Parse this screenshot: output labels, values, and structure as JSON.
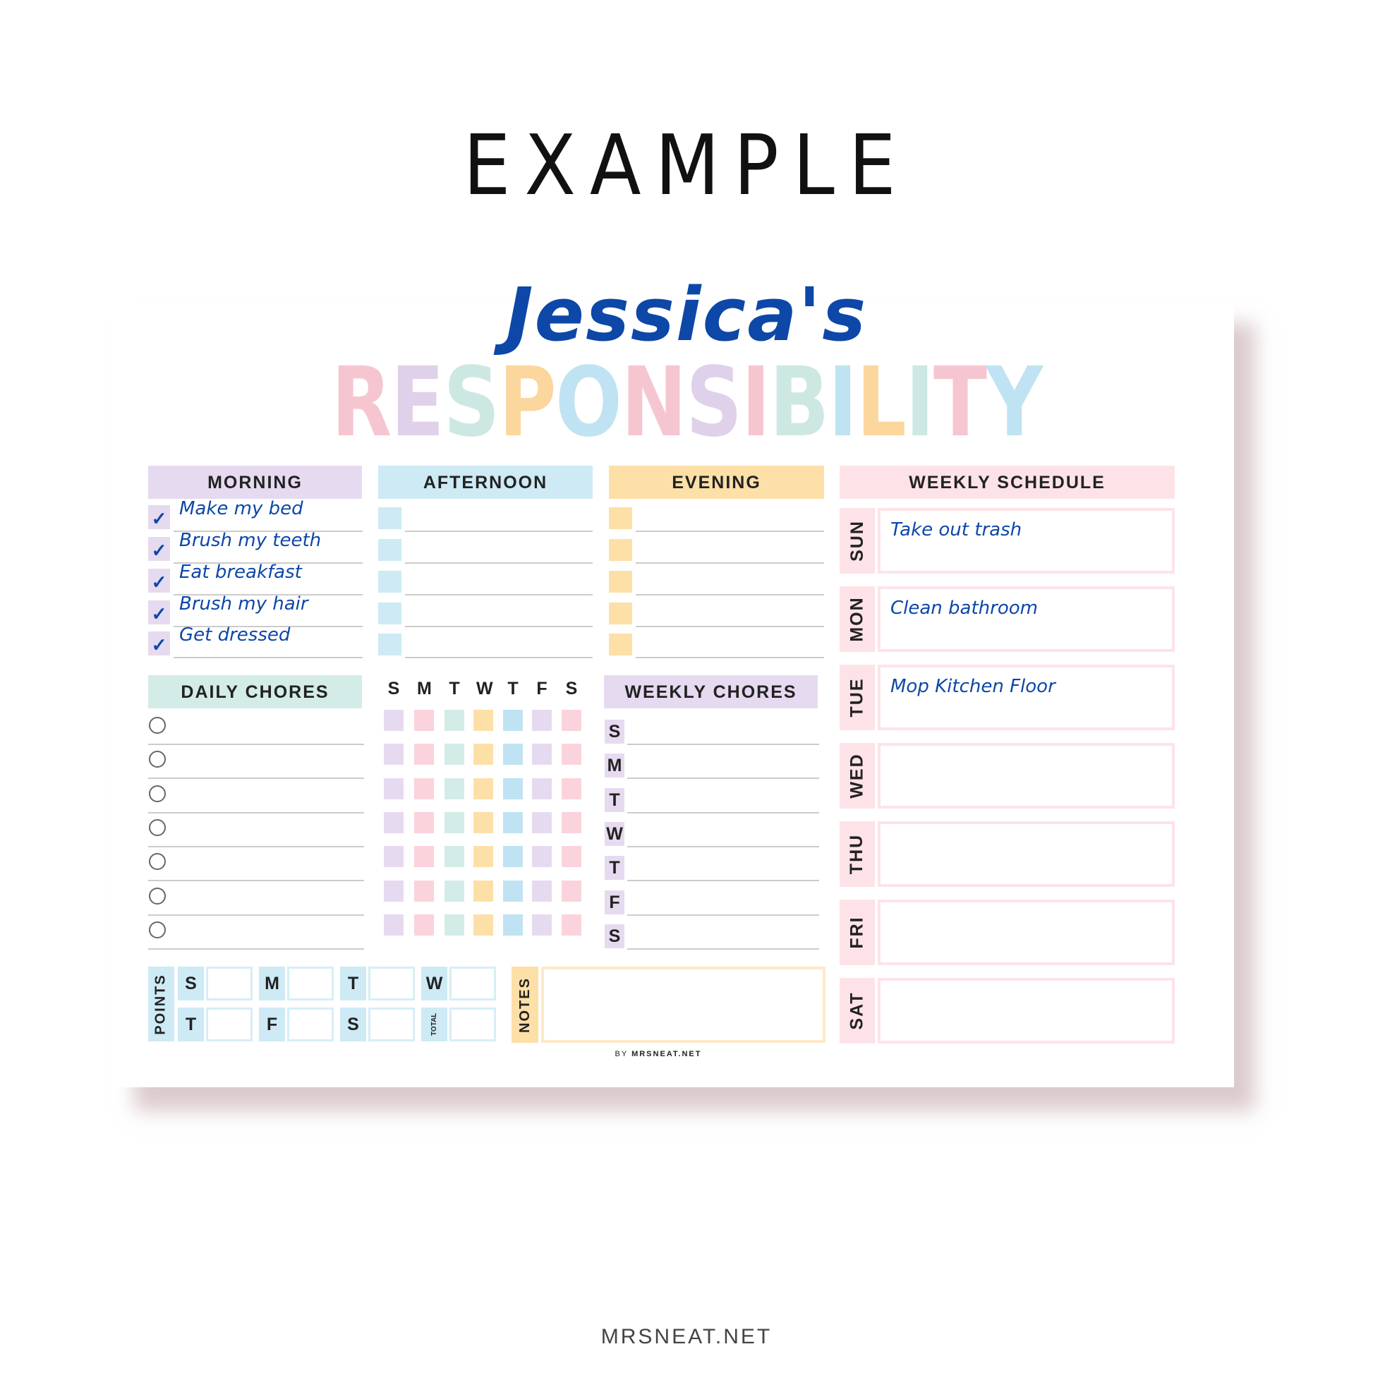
{
  "heading": "EXAMPLE",
  "owner_name": "Jessica's",
  "title": {
    "text": "RESPONSIBILITY",
    "letter_colors": [
      "#f6c6d0",
      "#e0d1ea",
      "#cde8e2",
      "#fbd69d",
      "#bfe3f2",
      "#f6c6d0",
      "#e0d1ea",
      "#f6c6d0",
      "#cde8e2",
      "#bfe3f2",
      "#fbd69d",
      "#cde8e2",
      "#f6c6d0",
      "#bfe3f2"
    ]
  },
  "colors": {
    "purple": "#e6daf0",
    "blue": "#cdeaf5",
    "orange": "#fddfa8",
    "pink": "#fde3e8",
    "teal": "#d3ece7",
    "ink": "#0d47a8"
  },
  "morning": {
    "header": "MORNING",
    "items": [
      {
        "text": "Make my bed",
        "checked": true
      },
      {
        "text": "Brush my teeth",
        "checked": true
      },
      {
        "text": "Eat breakfast",
        "checked": true
      },
      {
        "text": "Brush my hair",
        "checked": true
      },
      {
        "text": "Get dressed",
        "checked": true
      }
    ],
    "check_icon": "checkmark-icon"
  },
  "afternoon": {
    "header": "AFTERNOON"
  },
  "evening": {
    "header": "EVENING"
  },
  "daily_chores": {
    "header": "DAILY CHORES",
    "days": [
      "S",
      "M",
      "T",
      "W",
      "T",
      "F",
      "S"
    ]
  },
  "weekly_chores": {
    "header": "WEEKLY CHORES",
    "days": [
      "S",
      "M",
      "T",
      "W",
      "T",
      "F",
      "S"
    ]
  },
  "weekly_schedule": {
    "header": "WEEKLY SCHEDULE",
    "days": [
      {
        "day": "SUN",
        "task": "Take out trash"
      },
      {
        "day": "MON",
        "task": "Clean bathroom"
      },
      {
        "day": "TUE",
        "task": "Mop Kitchen Floor"
      },
      {
        "day": "WED",
        "task": ""
      },
      {
        "day": "THU",
        "task": ""
      },
      {
        "day": "FRI",
        "task": ""
      },
      {
        "day": "SAT",
        "task": ""
      }
    ]
  },
  "points": {
    "label": "POINTS",
    "cells": [
      "S",
      "M",
      "T",
      "W",
      "T",
      "F",
      "S",
      "TOTAL"
    ]
  },
  "notes": {
    "label": "NOTES"
  },
  "credit": {
    "by": "BY",
    "site": "MRSNEAT.NET"
  },
  "footer": "MRSNEAT.NET"
}
